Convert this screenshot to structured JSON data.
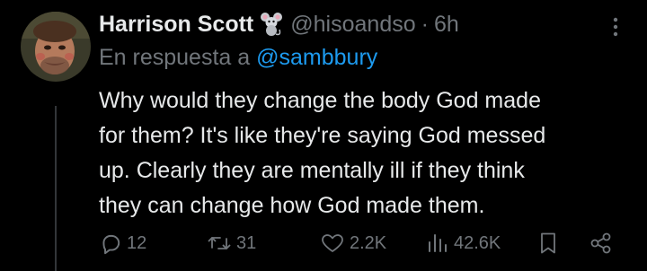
{
  "tweet": {
    "display_name": "Harrison Scott",
    "handle": "@hisoandso",
    "separator": "·",
    "time": "6h",
    "reply_prefix": "En respuesta a",
    "reply_mention": "@sambbury",
    "text_lines": [
      "Why would they change the body God made",
      "for them? It's like they're saying God messed",
      "up. Clearly they are mentally ill if they think",
      "they can change how God made them."
    ]
  },
  "actions": {
    "replies": "12",
    "retweets": "31",
    "likes": "2.2K",
    "views": "42.6K"
  },
  "colors": {
    "background": "#000000",
    "primary_text": "#e7e9ea",
    "secondary_text": "#71767b",
    "link": "#1d9bf0"
  },
  "icons": {
    "badge": "mouse-icon",
    "more": "more-options-icon",
    "reply": "reply-icon",
    "retweet": "retweet-icon",
    "like": "heart-icon",
    "views": "views-icon",
    "bookmark": "bookmark-icon",
    "share": "share-icon"
  }
}
